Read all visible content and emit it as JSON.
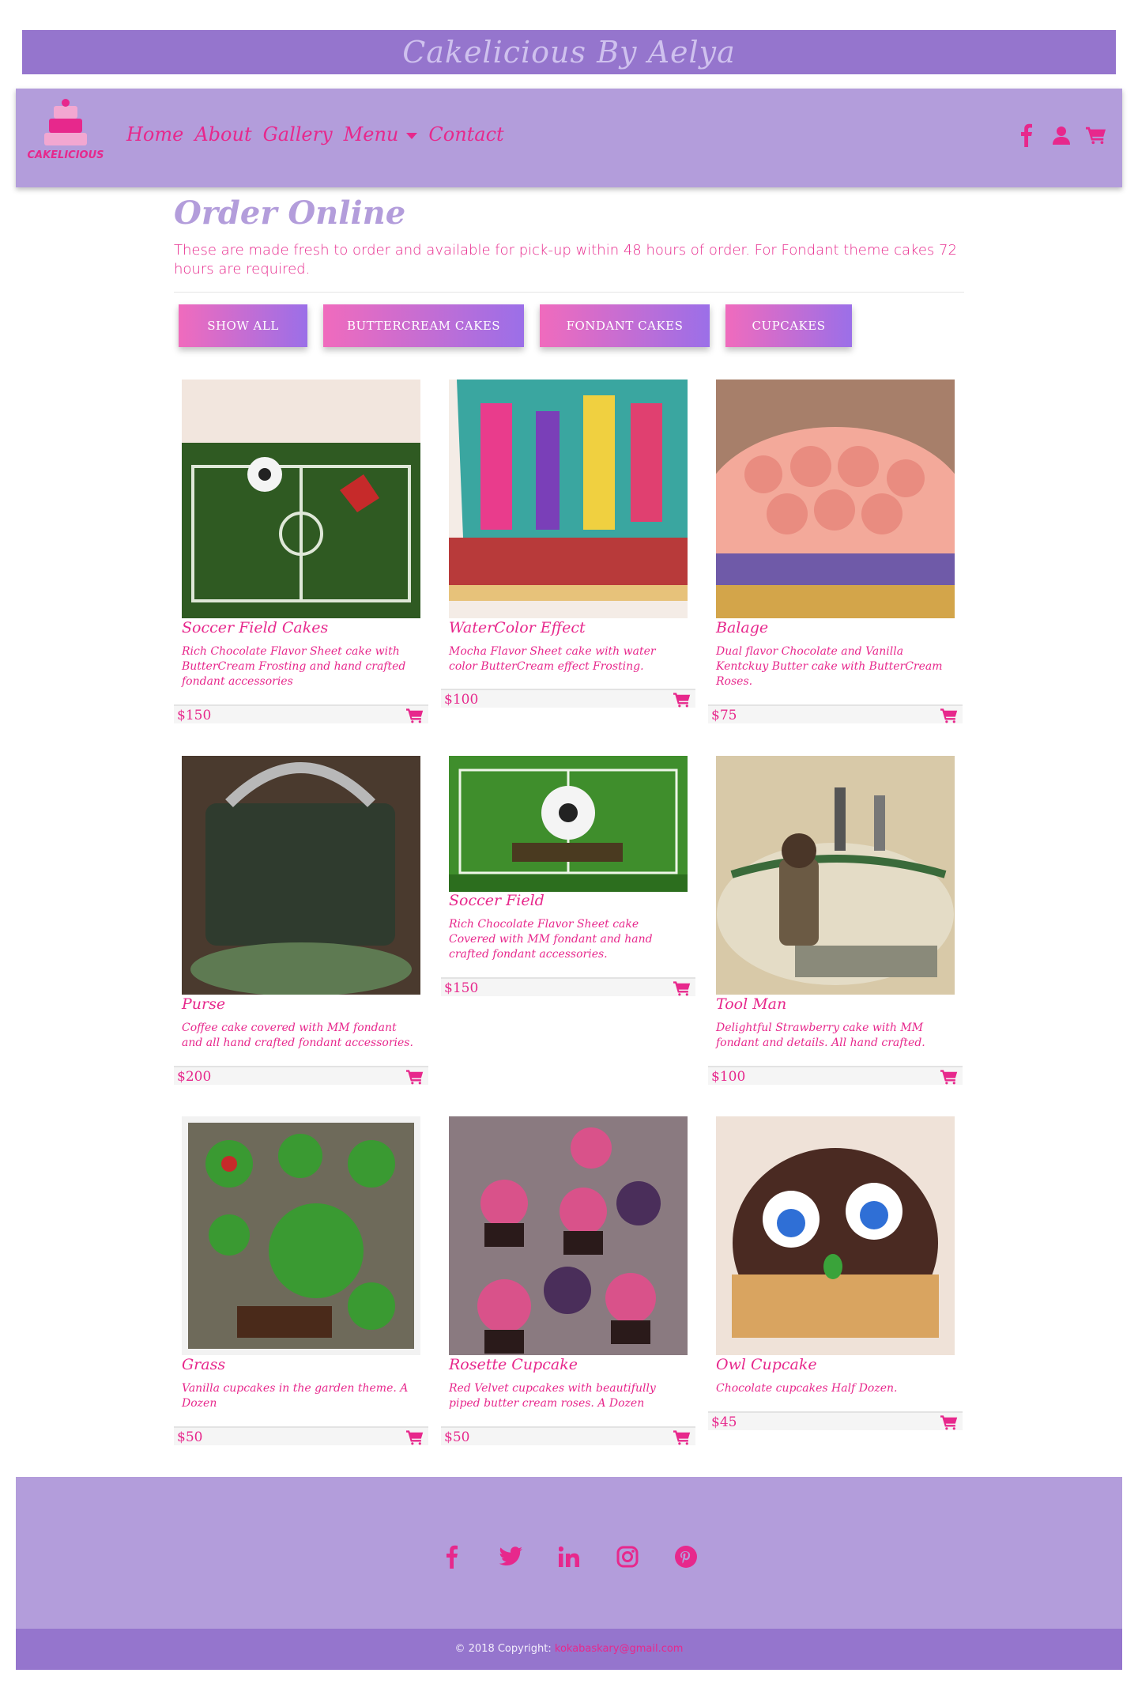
{
  "banner": {
    "title": "Cakelicious By Aelya"
  },
  "nav": {
    "logo_text": "CAKELICIOUS",
    "links": [
      "Home",
      "About",
      "Gallery",
      "Menu",
      "Contact"
    ],
    "icons": [
      "facebook-icon",
      "user-icon",
      "cart-icon"
    ]
  },
  "main": {
    "title": "Order Online",
    "intro": "These are made fresh to order and available for pick-up within 48 hours of order. For Fondant theme cakes 72 hours are required."
  },
  "filters": [
    "SHOW ALL",
    "BUTTERCREAM CAKES",
    "FONDANT CAKES",
    "CUPCAKES"
  ],
  "products": [
    {
      "name": "Soccer Field Cakes",
      "desc": "Rich Chocolate Flavor Sheet cake with ButterCream Frosting and hand crafted fondant accessories",
      "price": "$150"
    },
    {
      "name": "WaterColor Effect",
      "desc": "Mocha Flavor Sheet cake with water color ButterCream effect Frosting.",
      "price": "$100"
    },
    {
      "name": "Balage",
      "desc": "Dual flavor Chocolate and Vanilla Kentckuy Butter cake with ButterCream Roses.",
      "price": "$75"
    },
    {
      "name": "Purse",
      "desc": "Coffee cake covered with MM fondant and all hand crafted fondant accessories.",
      "price": "$200"
    },
    {
      "name": "Soccer Field",
      "desc": "Rich Chocolate Flavor Sheet cake Covered with MM fondant and hand crafted fondant accessories.",
      "price": "$150"
    },
    {
      "name": "Tool Man",
      "desc": "Delightful Strawberry cake with MM fondant and details. All hand crafted.",
      "price": "$100"
    },
    {
      "name": "Grass",
      "desc": "Vanilla cupcakes in the garden theme. A Dozen",
      "price": "$50"
    },
    {
      "name": "Rosette Cupcake",
      "desc": "Red Velvet cupcakes with beautifully piped butter cream roses. A Dozen",
      "price": "$50"
    },
    {
      "name": "Owl Cupcake",
      "desc": "Chocolate cupcakes Half Dozen.",
      "price": "$45"
    }
  ],
  "footer": {
    "social": [
      "facebook-icon",
      "twitter-icon",
      "linkedin-icon",
      "instagram-icon",
      "pinterest-icon"
    ],
    "copyright": "© 2018 Copyright:",
    "email": "kokabaskary@gmail.com"
  },
  "colors": {
    "accent": "#e7288c",
    "purple_light": "#b39ddb",
    "purple_dark": "#9575cd"
  }
}
